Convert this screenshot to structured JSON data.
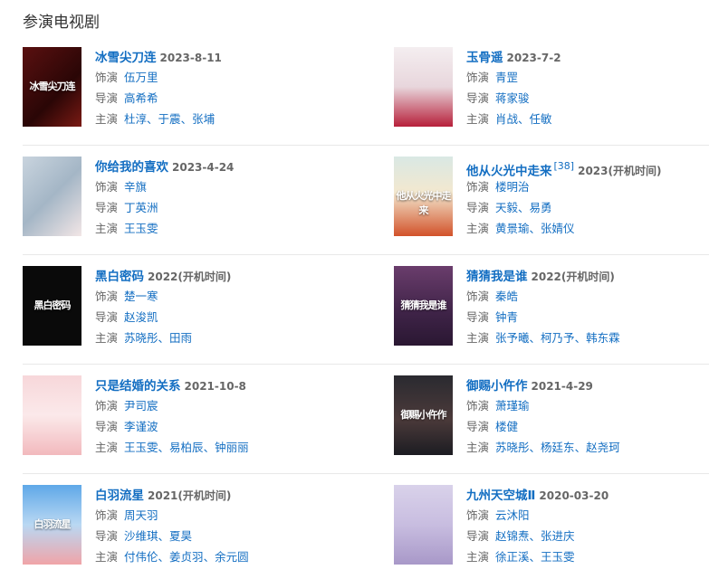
{
  "section": {
    "title": "参演电视剧"
  },
  "labels": {
    "role": "饰演",
    "director": "导演",
    "cast": "主演"
  },
  "shows": [
    {
      "title": "冰雪尖刀连",
      "year": "2023-8-11",
      "role": "伍万里",
      "director": [
        "高希希"
      ],
      "cast": [
        "杜淳",
        "于震",
        "张埔"
      ],
      "poster_text": "冰雪尖刀连",
      "poster_bg": "linear-gradient(135deg,#5a1010,#2a0606 60%,#7a1a14)"
    },
    {
      "title": "玉骨遥",
      "year": "2023-7-2",
      "role": "青罡",
      "director": [
        "蒋家骏"
      ],
      "cast": [
        "肖战",
        "任敏"
      ],
      "poster_text": "",
      "poster_bg": "linear-gradient(180deg,#f4eef0,#e8d6dc 50%,#b7203a 100%)"
    },
    {
      "title": "你给我的喜欢",
      "year": "2023-4-24",
      "role": "辛旗",
      "director": [
        "丁英洲"
      ],
      "cast": [
        "王玉雯"
      ],
      "poster_text": "",
      "poster_bg": "linear-gradient(135deg,#c9d4de,#a4b6c6 50%,#f2e6e6)"
    },
    {
      "title": "他从火光中走来",
      "citation": "[38]",
      "year": "2023(开机时间)",
      "role": "楼明治",
      "director": [
        "天毅",
        "易勇"
      ],
      "cast": [
        "黄景瑜",
        "张婧仪"
      ],
      "poster_text": "他从火光中走来",
      "poster_bg": "linear-gradient(180deg,#d9e8e4,#f3e8cf 45%,#d2522a 100%)"
    },
    {
      "title": "黑白密码",
      "year": "2022(开机时间)",
      "role": "楚一寒",
      "director": [
        "赵浚凯"
      ],
      "cast": [
        "苏晓彤",
        "田雨"
      ],
      "poster_text": "黑白密码",
      "poster_bg": "#0a0a0a"
    },
    {
      "title": "猜猜我是谁",
      "year": "2022(开机时间)",
      "role": "秦皓",
      "director": [
        "钟青"
      ],
      "cast": [
        "张予曦",
        "柯乃予",
        "韩东霖"
      ],
      "poster_text": "猜猜我是谁",
      "poster_bg": "linear-gradient(180deg,#6a3d6c,#3e2347 60%,#2a1732)"
    },
    {
      "title": "只是结婚的关系",
      "year": "2021-10-8",
      "role": "尹司宸",
      "director": [
        "李谨波"
      ],
      "cast": [
        "王玉雯",
        "易柏辰",
        "钟丽丽"
      ],
      "poster_text": "",
      "poster_bg": "linear-gradient(180deg,#f7d7da,#fbe9ea 50%,#f2b9bd)"
    },
    {
      "title": "御赐小仵作",
      "year": "2021-4-29",
      "role": "萧瑾瑜",
      "director": [
        "楼健"
      ],
      "cast": [
        "苏晓彤",
        "杨廷东",
        "赵尧珂"
      ],
      "poster_text": "御赐小仵作",
      "poster_bg": "linear-gradient(180deg,#2a2a30,#4b3a3a 55%,#1c1c22)"
    },
    {
      "title": "白羽流星",
      "year": "2021(开机时间)",
      "role": "周天羽",
      "director": [
        "沙维琪",
        "夏昊"
      ],
      "cast": [
        "付伟伦",
        "姜贞羽",
        "余元圆"
      ],
      "poster_text": "白羽流星",
      "poster_bg": "linear-gradient(180deg,#5fa8e8,#b9d8f3 50%,#f0a4a8)"
    },
    {
      "title": "九州天空城Ⅱ",
      "year": "2020-03-20",
      "role": "云沐阳",
      "director": [
        "赵锦焘",
        "张进庆"
      ],
      "cast": [
        "徐正溪",
        "王玉雯"
      ],
      "poster_text": "",
      "poster_bg": "linear-gradient(180deg,#d9d2ea,#c8bde0 50%,#a898c8)"
    }
  ]
}
